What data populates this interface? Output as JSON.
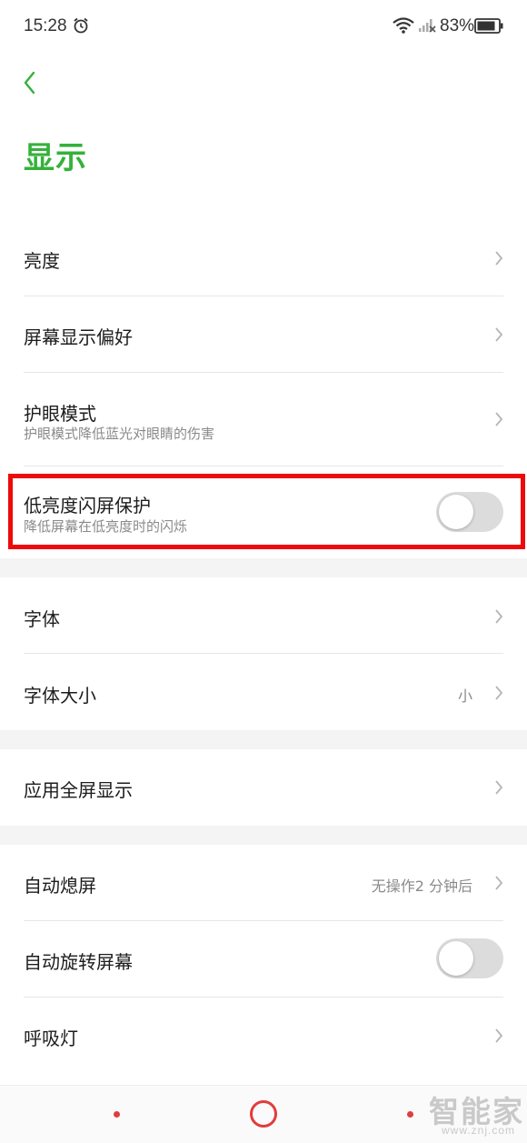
{
  "status_bar": {
    "time": "15:28",
    "battery_percent": "83%",
    "icons": [
      "alarm-icon",
      "wifi-icon",
      "signal-icon",
      "battery-icon"
    ]
  },
  "header": {
    "title": "显示",
    "back_icon": "chevron-left-icon"
  },
  "accent_color": "#35b13b",
  "highlight_color": "#ee0a0a",
  "settings": {
    "brightness": {
      "label": "亮度"
    },
    "screen_pref": {
      "label": "屏幕显示偏好"
    },
    "eye_care": {
      "label": "护眼模式",
      "desc": "护眼模式降低蓝光对眼睛的伤害"
    },
    "low_flicker": {
      "label": "低亮度闪屏保护",
      "desc": "降低屏幕在低亮度时的闪烁",
      "enabled": false
    },
    "font": {
      "label": "字体"
    },
    "font_size": {
      "label": "字体大小",
      "value": "小"
    },
    "fullscreen_apps": {
      "label": "应用全屏显示"
    },
    "auto_lock": {
      "label": "自动熄屏",
      "value": "无操作2 分钟后"
    },
    "auto_rotate": {
      "label": "自动旋转屏幕",
      "enabled": false
    },
    "breathing_light": {
      "label": "呼吸灯"
    }
  },
  "watermark": {
    "text": "智能家",
    "url": "www.znj.com"
  }
}
